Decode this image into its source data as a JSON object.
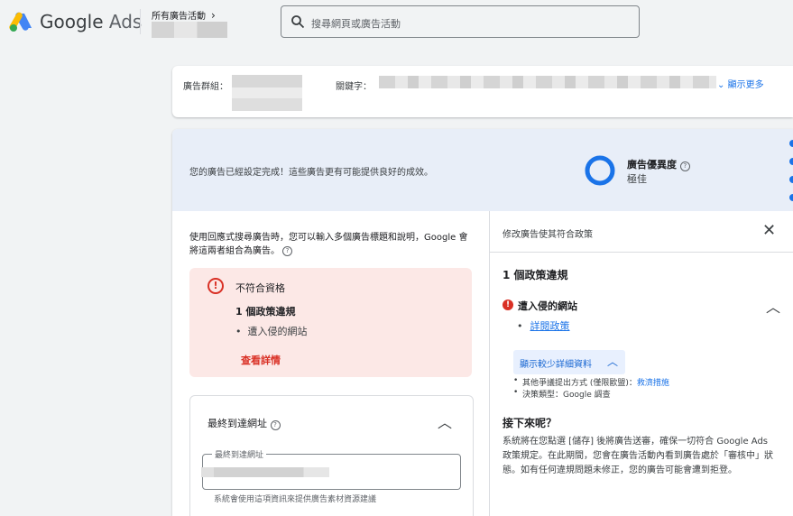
{
  "header": {
    "logo_word_google": "Google",
    "logo_word_ads": "Ads",
    "breadcrumb": "所有廣告活動",
    "search_placeholder": "搜尋網頁或廣告活動"
  },
  "info_bar": {
    "ad_group_label": "廣告群組：",
    "keywords_label": "關鍵字：",
    "show_more": "顯示更多"
  },
  "banner": {
    "message": "您的廣告已經設定完成！這些廣告更有可能提供良好的成效。",
    "strength_label": "廣告優異度",
    "strength_value": "極佳"
  },
  "left": {
    "description": "使用回應式搜尋廣告時，您可以輸入多個廣告標題和說明，Google 會將這兩者組合為廣告。",
    "alert_title": "不符合資格",
    "alert_violations": "1 個政策違規",
    "alert_item": "遭入侵的網站",
    "alert_link": "查看詳情",
    "final_url_title": "最終到達網址",
    "final_url_legend": "最終到達網址",
    "final_url_hint": "系統會使用這項資訊來提供廣告素材資源建議"
  },
  "panel": {
    "title": "修改廣告使其符合政策",
    "violation_count": "1 個政策違規",
    "violation_name": "遭入侵的網站",
    "read_policy": "詳閱政策",
    "less_details": "顯示較少詳細資料",
    "detail_other_prefix": "其他爭議提出方式 (僅限歐盟)：",
    "detail_other_link": "救濟措施",
    "detail_decision": "決策類型：Google 調查",
    "next_title": "接下來呢？",
    "next_body": "系統將在您點選 [儲存] 後將廣告送審，確保一切符合 Google Ads 政策規定。在此期間，您會在廣告活動內看到廣告處於「審核中」狀態。如有任何違規問題未修正，您的廣告可能會遭到拒登。"
  },
  "colors": {
    "accent": "#1a73e8",
    "error": "#d93025",
    "banner_bg": "#e8eef8",
    "alert_bg": "#fce8e6"
  }
}
